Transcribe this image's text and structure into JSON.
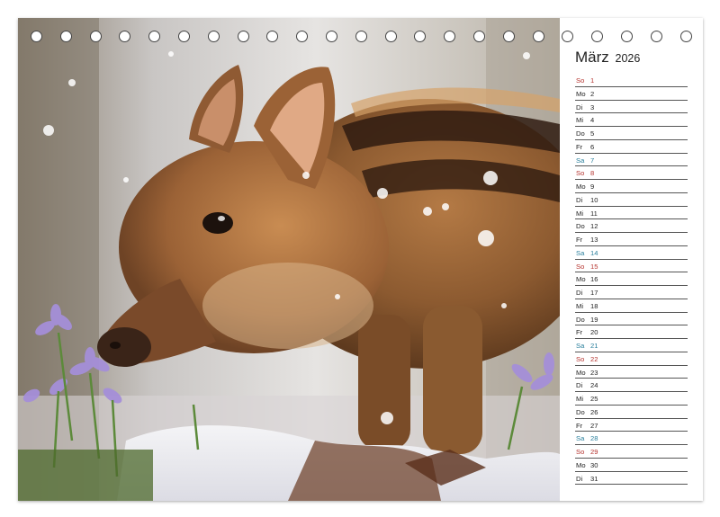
{
  "calendar": {
    "month": "März",
    "year": "2026",
    "days": [
      {
        "wd": "So",
        "d": "1",
        "type": "sun"
      },
      {
        "wd": "Mo",
        "d": "2",
        "type": "wk"
      },
      {
        "wd": "Di",
        "d": "3",
        "type": "wk"
      },
      {
        "wd": "Mi",
        "d": "4",
        "type": "wk"
      },
      {
        "wd": "Do",
        "d": "5",
        "type": "wk"
      },
      {
        "wd": "Fr",
        "d": "6",
        "type": "wk"
      },
      {
        "wd": "Sa",
        "d": "7",
        "type": "sat"
      },
      {
        "wd": "So",
        "d": "8",
        "type": "sun"
      },
      {
        "wd": "Mo",
        "d": "9",
        "type": "wk"
      },
      {
        "wd": "Di",
        "d": "10",
        "type": "wk"
      },
      {
        "wd": "Mi",
        "d": "11",
        "type": "wk"
      },
      {
        "wd": "Do",
        "d": "12",
        "type": "wk"
      },
      {
        "wd": "Fr",
        "d": "13",
        "type": "wk"
      },
      {
        "wd": "Sa",
        "d": "14",
        "type": "sat"
      },
      {
        "wd": "So",
        "d": "15",
        "type": "sun"
      },
      {
        "wd": "Mo",
        "d": "16",
        "type": "wk"
      },
      {
        "wd": "Di",
        "d": "17",
        "type": "wk"
      },
      {
        "wd": "Mi",
        "d": "18",
        "type": "wk"
      },
      {
        "wd": "Do",
        "d": "19",
        "type": "wk"
      },
      {
        "wd": "Fr",
        "d": "20",
        "type": "wk"
      },
      {
        "wd": "Sa",
        "d": "21",
        "type": "sat"
      },
      {
        "wd": "So",
        "d": "22",
        "type": "sun"
      },
      {
        "wd": "Mo",
        "d": "23",
        "type": "wk"
      },
      {
        "wd": "Di",
        "d": "24",
        "type": "wk"
      },
      {
        "wd": "Mi",
        "d": "25",
        "type": "wk"
      },
      {
        "wd": "Do",
        "d": "26",
        "type": "wk"
      },
      {
        "wd": "Fr",
        "d": "27",
        "type": "wk"
      },
      {
        "wd": "Sa",
        "d": "28",
        "type": "sat"
      },
      {
        "wd": "So",
        "d": "29",
        "type": "sun"
      },
      {
        "wd": "Mo",
        "d": "30",
        "type": "wk"
      },
      {
        "wd": "Di",
        "d": "31",
        "type": "wk"
      }
    ]
  },
  "colors": {
    "saturday": "#2a7f9c",
    "sunday": "#b5332e",
    "text": "#222222"
  },
  "photo": {
    "icon": "wild-boar-piglet-photo"
  }
}
